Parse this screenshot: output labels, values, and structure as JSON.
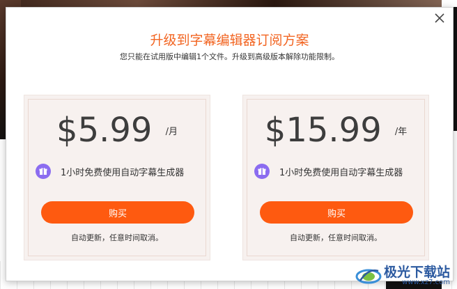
{
  "dialog": {
    "title": "升级到字幕编辑器订阅方案",
    "subtitle": "您只能在试用版中编辑1个文件。升级到高级版本解除功能限制。"
  },
  "plans": [
    {
      "price": "$5.99",
      "period": "/月",
      "feature": "1小时免费使用自动字幕生成器",
      "buy_label": "购买",
      "renew_note": "自动更新，任意时间取消。"
    },
    {
      "price": "$15.99",
      "period": "/年",
      "feature": "1小时免费使用自动字幕生成器",
      "buy_label": "购买",
      "renew_note": "自动更新，任意时间取消。"
    }
  ],
  "watermark": {
    "name": "极光下载站",
    "url": "www.xz7.com"
  },
  "colors": {
    "accent": "#f26522",
    "button": "#fe5a10",
    "gift_icon": "#8b6cf0",
    "card_bg": "#f7f1ef"
  },
  "icons": [
    "close-icon",
    "gift-icon"
  ]
}
